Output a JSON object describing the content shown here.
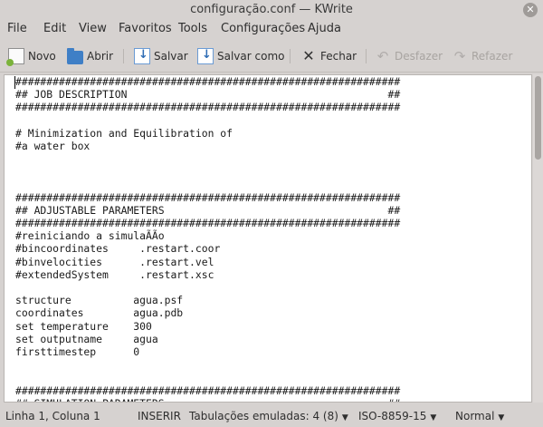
{
  "window": {
    "title": "configuração.conf — KWrite"
  },
  "menu": [
    "File",
    "Edit",
    "View",
    "Favoritos",
    "Tools",
    "Configurações",
    "Ajuda"
  ],
  "toolbar": {
    "new_label": "Novo",
    "open_label": "Abrir",
    "save_label": "Salvar",
    "save_as_label": "Salvar como",
    "close_label": "Fechar",
    "undo_label": "Desfazer",
    "redo_label": "Refazer"
  },
  "editor": {
    "lines": [
      "##############################################################",
      "## JOB DESCRIPTION                                          ##",
      "##############################################################",
      "",
      "# Minimization and Equilibration of",
      "#a water box",
      "",
      "",
      "",
      "##############################################################",
      "## ADJUSTABLE PARAMETERS                                    ##",
      "##############################################################",
      "#reiniciando a simulaÃÃo",
      "#bincoordinates     .restart.coor",
      "#binvelocities      .restart.vel",
      "#extendedSystem     .restart.xsc",
      "",
      "structure          agua.psf",
      "coordinates        agua.pdb",
      "set temperature    300",
      "set outputname     agua",
      "firsttimestep      0",
      "",
      "",
      "##############################################################",
      "## SIMULATION PARAMETERS                                    ##"
    ]
  },
  "status": {
    "position": "Linha 1, Coluna 1",
    "mode": "INSERIR",
    "tabs": "Tabulações emuladas: 4 (8)",
    "encoding": "ISO-8859-15",
    "highlight": "Normal"
  }
}
